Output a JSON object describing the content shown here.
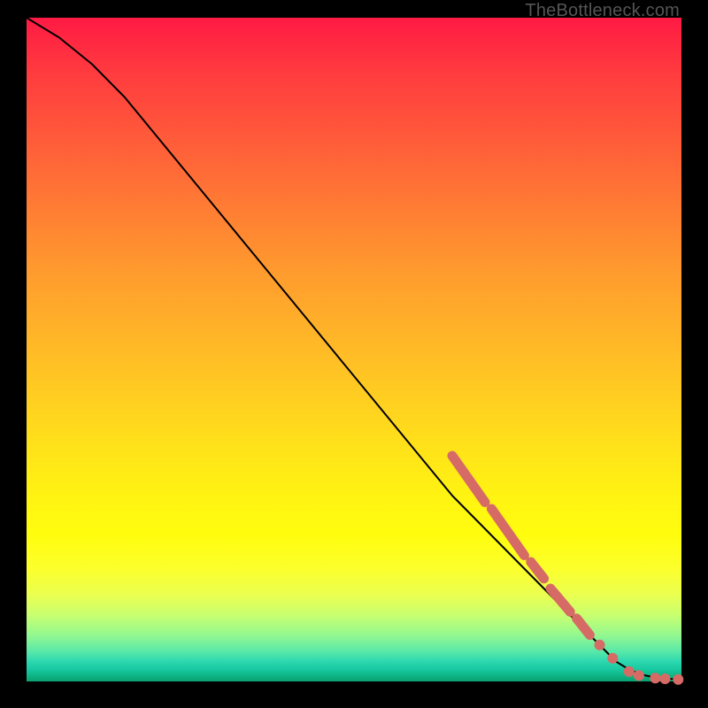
{
  "watermark": "TheBottleneck.com",
  "colors": {
    "dot": "#d66b66",
    "curve": "#000000",
    "frame": "#000000"
  },
  "chart_data": {
    "type": "line",
    "title": "",
    "xlabel": "",
    "ylabel": "",
    "xlim": [
      0,
      100
    ],
    "ylim": [
      0,
      100
    ],
    "curve": {
      "x": [
        0,
        5,
        10,
        15,
        20,
        25,
        30,
        35,
        40,
        45,
        50,
        55,
        60,
        65,
        70,
        75,
        80,
        85,
        88,
        90,
        92,
        94,
        96,
        98,
        100
      ],
      "y": [
        100,
        97,
        93,
        88,
        82,
        76,
        70,
        64,
        58,
        52,
        46,
        40,
        34,
        28,
        23,
        18,
        13,
        8,
        5,
        3,
        1.8,
        1.0,
        0.6,
        0.4,
        0.3
      ]
    },
    "highlight_segments": [
      {
        "x0": 65,
        "y0": 34,
        "x1": 70,
        "y1": 27
      },
      {
        "x0": 71,
        "y0": 26,
        "x1": 76,
        "y1": 19
      },
      {
        "x0": 77,
        "y0": 18,
        "x1": 79,
        "y1": 15.5
      },
      {
        "x0": 80,
        "y0": 14,
        "x1": 83,
        "y1": 10.5
      },
      {
        "x0": 84,
        "y0": 9.5,
        "x1": 86,
        "y1": 7
      }
    ],
    "scatter": [
      {
        "x": 87.5,
        "y": 5.5
      },
      {
        "x": 89.5,
        "y": 3.5
      },
      {
        "x": 92,
        "y": 1.5
      },
      {
        "x": 93.5,
        "y": 0.9
      },
      {
        "x": 96,
        "y": 0.5
      },
      {
        "x": 97.5,
        "y": 0.4
      },
      {
        "x": 99.5,
        "y": 0.3
      }
    ]
  }
}
